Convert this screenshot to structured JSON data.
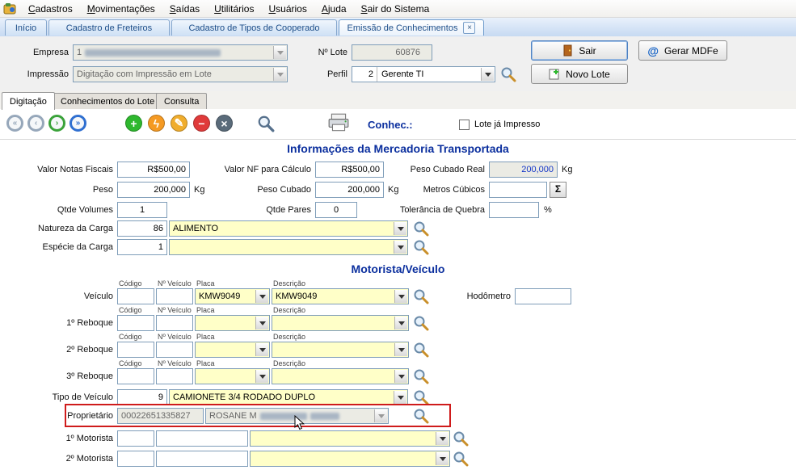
{
  "menu": {
    "items": [
      "Cadastros",
      "Movimentações",
      "Saídas",
      "Utilitários",
      "Usuários",
      "Ajuda",
      "Sair do Sistema"
    ]
  },
  "tabs": [
    {
      "label": "Início"
    },
    {
      "label": "Cadastro de Freteiros"
    },
    {
      "label": "Cadastro de Tipos de Cooperado"
    },
    {
      "label": "Emissão de Conhecimentos"
    }
  ],
  "header": {
    "empresa": {
      "label": "Empresa",
      "code": "1"
    },
    "lote": {
      "label": "Nº Lote",
      "value": "60876"
    },
    "impressao": {
      "label": "Impressão",
      "value": "Digitação com Impressão em Lote"
    },
    "perfil": {
      "label": "Perfil",
      "code": "2",
      "value": "Gerente TI"
    },
    "buttons": {
      "sair": "Sair",
      "gerar": "Gerar MDFe",
      "novo": "Novo Lote"
    }
  },
  "subtabs": {
    "digitacao": "Digitação",
    "conhecimentos": "Conhecimentos do Lote",
    "consulta": "Consulta"
  },
  "toolbar": {
    "conhec": "Conhec.:",
    "lote_impresso": "Lote já Impresso"
  },
  "mercadoria": {
    "title": "Informações da Mercadoria Transportada",
    "valor_notas": {
      "label": "Valor Notas Fiscais",
      "value": "R$500,00"
    },
    "valor_nf_calculo": {
      "label": "Valor NF para Cálculo",
      "value": "R$500,00"
    },
    "peso_cubado_real": {
      "label": "Peso Cubado Real",
      "value": "200,000",
      "unit": "Kg"
    },
    "peso": {
      "label": "Peso",
      "value": "200,000",
      "unit": "Kg"
    },
    "peso_cubado": {
      "label": "Peso Cubado",
      "value": "200,000",
      "unit": "Kg"
    },
    "metros_cubicos": {
      "label": "Metros Cúbicos",
      "value": "",
      "sigma": "Σ"
    },
    "qtde_volumes": {
      "label": "Qtde Volumes",
      "value": "1"
    },
    "qtde_pares": {
      "label": "Qtde Pares",
      "value": "0"
    },
    "tolerancia": {
      "label": "Tolerância de Quebra",
      "value": "",
      "unit": "%"
    },
    "natureza": {
      "label": "Natureza da Carga",
      "code": "86",
      "value": "ALIMENTO"
    },
    "especie": {
      "label": "Espécie da Carga",
      "code": "1",
      "value": ""
    }
  },
  "motorista_veiculo": {
    "title": "Motorista/Veículo",
    "headers": {
      "codigo": "Código",
      "num": "Nº Veículo",
      "placa": "Placa",
      "descricao": "Descrição"
    },
    "veiculo": {
      "label": "Veículo",
      "codigo": "",
      "num": "",
      "placa": "KMW9049",
      "descricao": "KMW9049"
    },
    "hodometro": {
      "label": "Hodômetro",
      "value": ""
    },
    "reboque1": {
      "label": "1º Reboque"
    },
    "reboque2": {
      "label": "2º Reboque"
    },
    "reboque3": {
      "label": "3º Reboque"
    },
    "tipo": {
      "label": "Tipo de Veículo",
      "code": "9",
      "value": "CAMIONETE 3/4 RODADO DUPLO"
    },
    "proprietario": {
      "label": "Proprietário",
      "code": "00022651335827",
      "value": "ROSANE M"
    },
    "motorista1": {
      "label": "1º Motorista"
    },
    "motorista2": {
      "label": "2º Motorista"
    }
  }
}
